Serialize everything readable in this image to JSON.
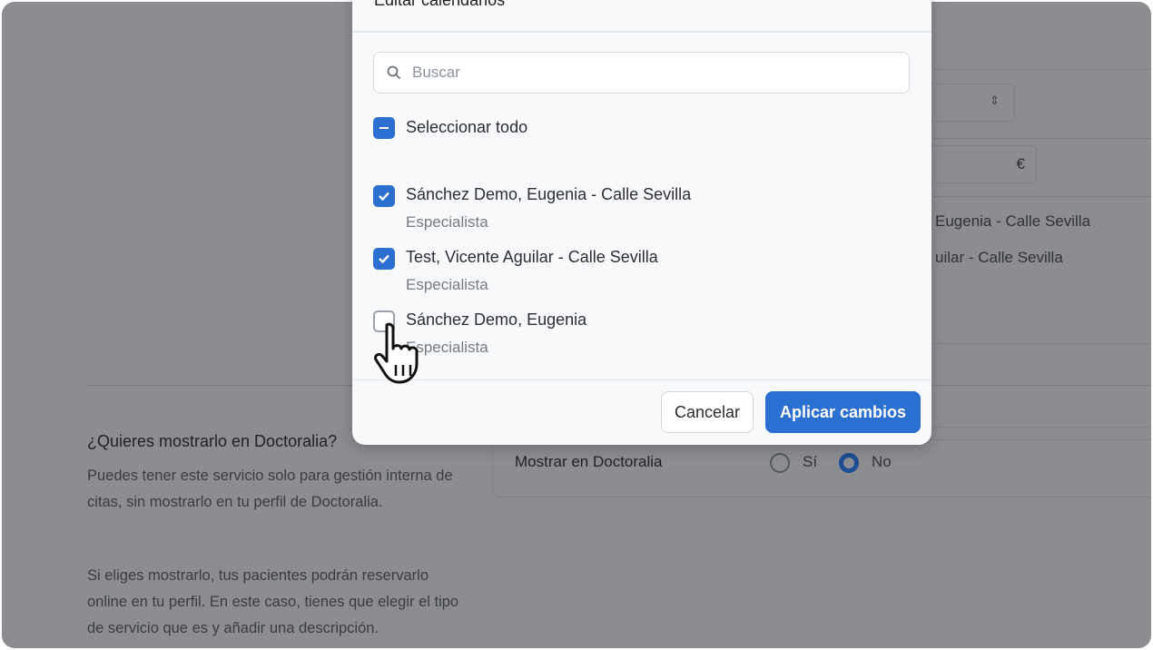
{
  "background": {
    "stepper_icon": "up-down-icon",
    "currency_symbol": "€",
    "calendar_lines": [
      "Eugenia - Calle Sevilla",
      "uilar - Calle Sevilla"
    ],
    "section_title": "¿Quieres mostrarlo en Doctoralia?",
    "paragraph1": "Puedes tener este servicio solo para gestión interna de citas, sin mostrarlo en tu perfil de Doctoralia.",
    "paragraph2": "Si eliges mostrarlo, tus pacientes podrán reservarlo online en tu perfil. En este caso, tienes que elegir el tipo de servicio que es y añadir una descripción.",
    "show_label": "Mostrar en Doctoralia",
    "radio_yes": "Sí",
    "radio_no": "No",
    "selected": "No"
  },
  "modal": {
    "title": "Editar calendarios",
    "search_placeholder": "Buscar",
    "select_all": "Seleccionar todo",
    "items": [
      {
        "name": "Sánchez Demo, Eugenia - Calle Sevilla",
        "role": "Especialista",
        "checked": true
      },
      {
        "name": "Test, Vicente Aguilar - Calle Sevilla",
        "role": "Especialista",
        "checked": true
      },
      {
        "name": "Sánchez Demo, Eugenia",
        "role": "Especialista",
        "checked": false
      }
    ],
    "cancel": "Cancelar",
    "apply": "Aplicar cambios"
  },
  "colors": {
    "accent": "#2b6fd0",
    "overlay": "#8b8d91"
  }
}
